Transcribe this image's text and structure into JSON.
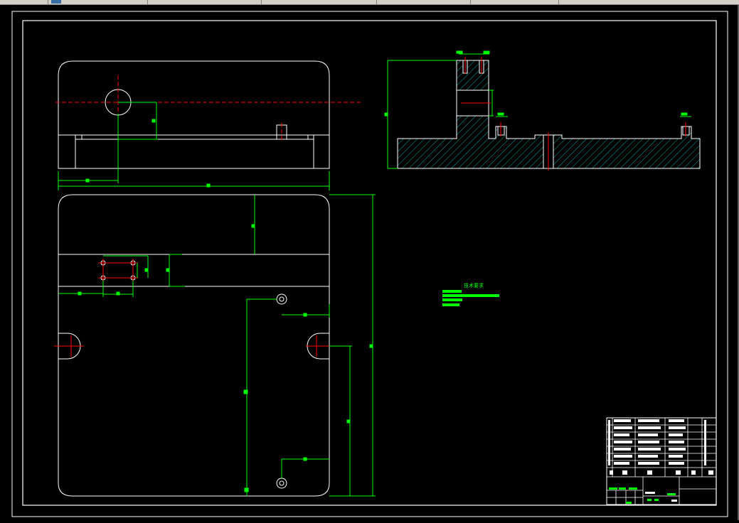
{
  "window": {
    "tabs": [
      "",
      "",
      "",
      "",
      "",
      "",
      ""
    ]
  },
  "drawing": {
    "note_title": "技术要求",
    "title_block_rows": 8
  },
  "colors": {
    "background": "#000000",
    "outline": "#ffffff",
    "dimension": "#00ff00",
    "centerline": "#ff0000",
    "hatch": "#00ffff"
  }
}
